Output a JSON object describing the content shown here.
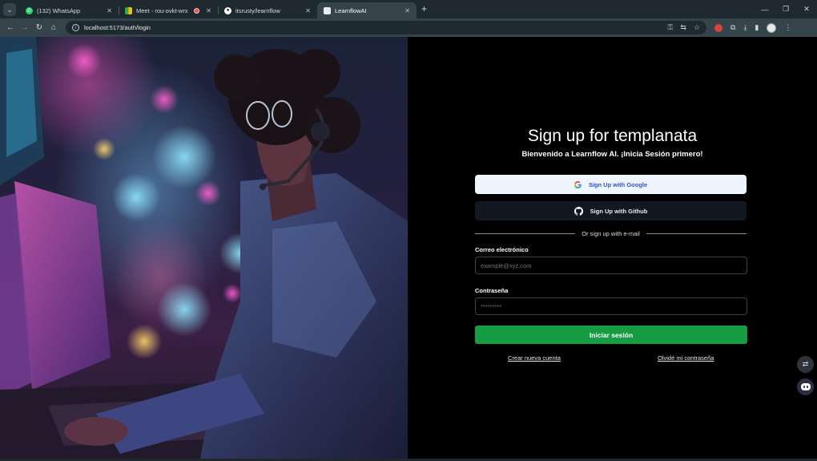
{
  "browser": {
    "tabs": [
      {
        "title": "(132) WhatsApp",
        "icon": "whatsapp-icon",
        "active": false
      },
      {
        "title": "Meet - rou-ovkt-wrx",
        "icon": "google-meet-icon",
        "active": false
      },
      {
        "title": "itsrusty/learnflow",
        "icon": "github-icon",
        "active": false
      },
      {
        "title": "LearnflowAI",
        "icon": "page-icon",
        "active": true
      }
    ],
    "url": "localhost:5173/auth/login",
    "colors": {
      "tabbar": "#1f2a30",
      "toolbar": "#35434b",
      "omnibox": "#1f2a30"
    }
  },
  "login": {
    "title": "Sign up for templanata",
    "subtitle": "Bienvenido a Learnflow AI. ¡Inicia Sesión primero!",
    "google_button": "Sign Up with Google",
    "github_button": "Sign Up with Github",
    "divider_text": "Or sign up with e-mail",
    "email_label": "Correo electrónico",
    "email_placeholder": "example@xyz.com",
    "password_label": "Contraseña",
    "password_placeholder": "*********",
    "submit_button": "Iniciar sesión",
    "create_account_link": "Crear nueva cuenta",
    "forgot_password_link": "Olvidé mi contraseña",
    "colors": {
      "submit": "#169c43",
      "google_button_bg": "#eef5ff",
      "github_button_bg": "#111821",
      "background": "#000000"
    }
  }
}
